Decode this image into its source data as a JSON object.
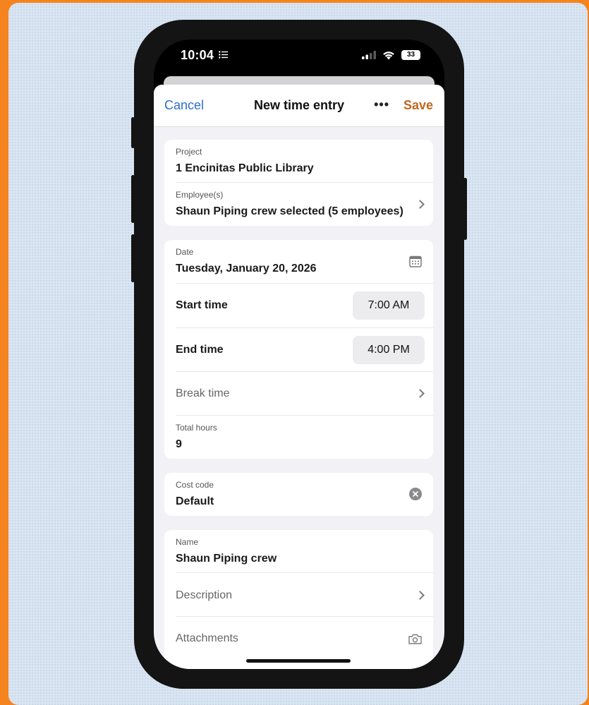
{
  "status_bar": {
    "time": "10:04",
    "battery": "33"
  },
  "nav": {
    "cancel": "Cancel",
    "title": "New time entry",
    "more": "•••",
    "save": "Save"
  },
  "project_card": {
    "project_label": "Project",
    "project_value": "1 Encinitas Public Library",
    "employees_label": "Employee(s)",
    "employees_value": "Shaun Piping crew selected (5 employees)"
  },
  "time_card": {
    "date_label": "Date",
    "date_value": "Tuesday, January 20, 2026",
    "start_label": "Start time",
    "start_value": "7:00 AM",
    "end_label": "End time",
    "end_value": "4:00 PM",
    "break_label": "Break time",
    "total_label": "Total hours",
    "total_value": "9"
  },
  "cost_card": {
    "label": "Cost code",
    "value": "Default"
  },
  "name_card": {
    "name_label": "Name",
    "name_value": "Shaun Piping crew",
    "description_label": "Description",
    "attachments_label": "Attachments"
  },
  "colors": {
    "accent_blue": "#2e6fc9",
    "save_orange": "#c0681f",
    "frame_orange": "#f5841f",
    "background": "#d9e5f2"
  }
}
